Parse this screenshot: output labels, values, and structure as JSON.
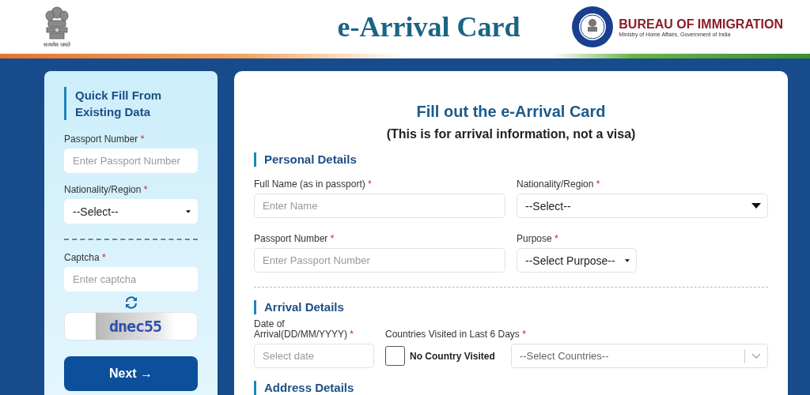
{
  "header": {
    "emblem_motto": "सत्यमेव जयते",
    "title": "e-Arrival Card",
    "bureau_title": "BUREAU OF IMMIGRATION",
    "bureau_subtitle": "Ministry of Home Affairs, Government of India"
  },
  "quick_fill": {
    "title": "Quick Fill From Existing Data",
    "fields": [
      {
        "kind": "input",
        "label": "Passport Number",
        "mark": "*",
        "placeholder": "Enter Passport Number"
      },
      {
        "kind": "select",
        "label": "Nationality/Region",
        "mark": "*",
        "value": "--Select--"
      }
    ],
    "captcha": {
      "label": "Captcha",
      "mark": "*",
      "placeholder": "Enter captcha",
      "code": "dnec55"
    },
    "next_button": "Next →"
  },
  "form": {
    "title": "Fill out the e-Arrival Card",
    "subtitle": "(This is for arrival information, not a visa)",
    "personal": {
      "heading": "Personal Details",
      "fields": [
        {
          "kind": "input",
          "label": "Full Name (as in passport)",
          "mark": "*",
          "placeholder": "Enter Name"
        },
        {
          "kind": "select",
          "label": "Nationality/Region",
          "mark": "*",
          "value": "--Select--"
        },
        {
          "kind": "input",
          "label": "Passport Number",
          "mark": "*",
          "placeholder": "Enter Passport Number"
        },
        {
          "kind": "small-select",
          "label": "Purpose",
          "mark": "*",
          "value": "--Select Purpose--"
        }
      ]
    },
    "arrival": {
      "heading": "Arrival Details",
      "date": {
        "label": "Date of Arrival(DD/MM/YYYY)",
        "mark": "*",
        "placeholder": "Select date"
      },
      "countries": {
        "label": "Countries Visited in Last 6 Days",
        "mark": "*",
        "no_country": {
          "label": "No Country Visited",
          "checked": false
        },
        "placeholder": "--Select Countries--"
      }
    },
    "address": {
      "heading": "Address Details"
    }
  }
}
